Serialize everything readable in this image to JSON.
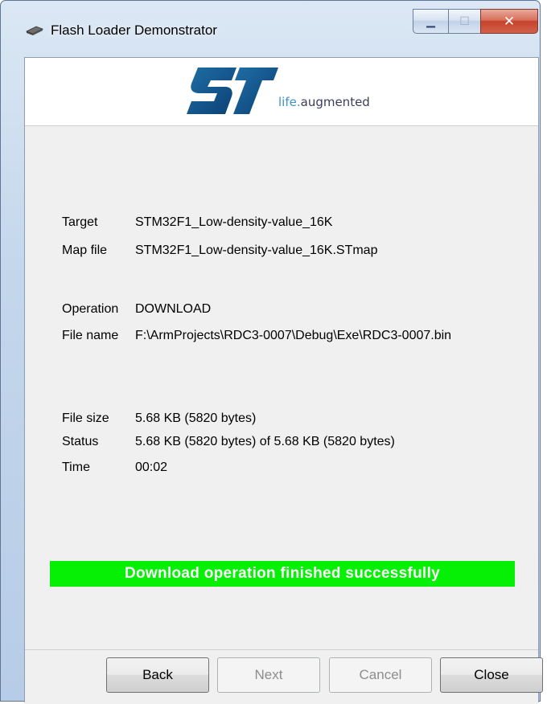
{
  "window": {
    "title": "Flash Loader Demonstrator",
    "minimize_glyph": "▁",
    "maximize_glyph": "☐",
    "close_glyph": "✕"
  },
  "branding": {
    "logo": "ST",
    "tagline_part1": "life.",
    "tagline_part2": "augmented"
  },
  "info": {
    "target_label": "Target",
    "target_value": "STM32F1_Low-density-value_16K",
    "mapfile_label": "Map file",
    "mapfile_value": "STM32F1_Low-density-value_16K.STmap",
    "operation_label": "Operation",
    "operation_value": "DOWNLOAD",
    "filename_label": "File name",
    "filename_value": "F:\\ArmProjects\\RDC3-0007\\Debug\\Exe\\RDC3-0007.bin",
    "filesize_label": "File size",
    "filesize_value": "5.68 KB (5820 bytes)",
    "status_label": "Status",
    "status_value": "5.68 KB (5820 bytes) of 5.68 KB (5820 bytes)",
    "time_label": "Time",
    "time_value": "00:02"
  },
  "progress": {
    "message": "Download operation finished successfully",
    "fraction": 1.0,
    "color": "#06f006"
  },
  "buttons": {
    "back": "Back",
    "next": "Next",
    "cancel": "Cancel",
    "close": "Close"
  },
  "icons": {
    "app": "chip-icon",
    "logo": "st-logo-icon"
  }
}
